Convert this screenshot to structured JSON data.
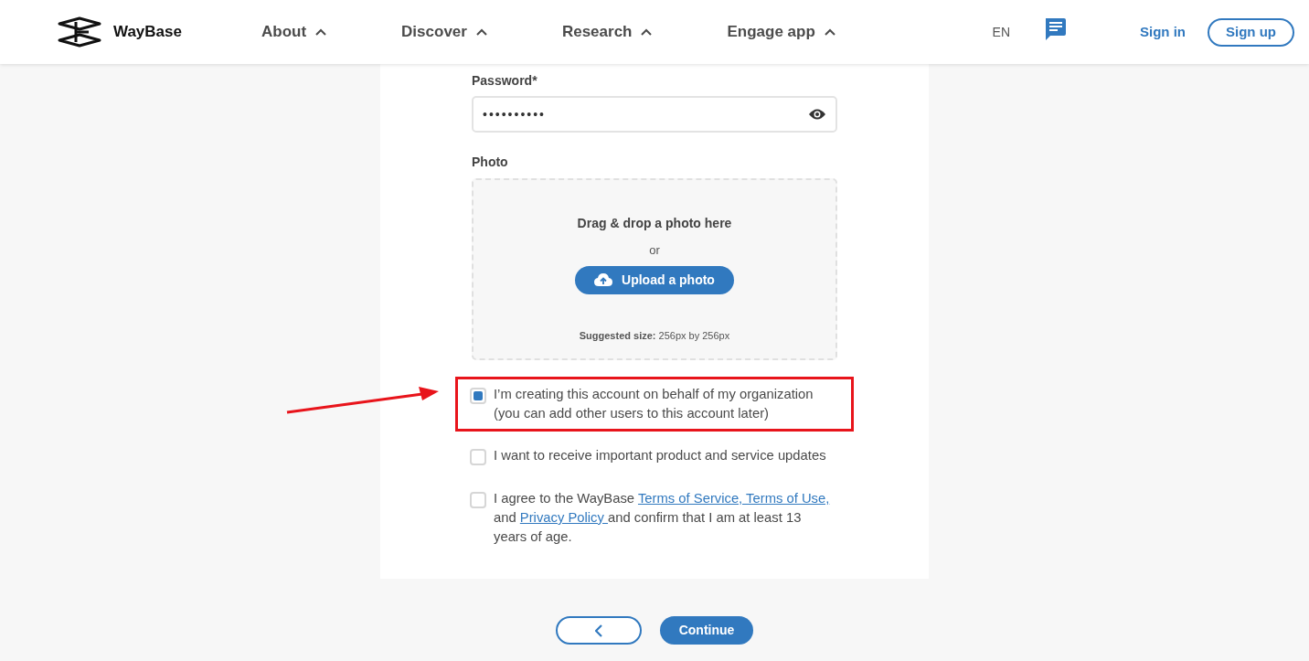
{
  "header": {
    "brand": "WayBase",
    "nav": [
      {
        "label": "About"
      },
      {
        "label": "Discover"
      },
      {
        "label": "Research"
      },
      {
        "label": "Engage app"
      }
    ],
    "language": "EN",
    "sign_in": "Sign in",
    "sign_up": "Sign up"
  },
  "form": {
    "password": {
      "label": "Password*",
      "value": "••••••••••"
    },
    "photo": {
      "label": "Photo",
      "drop_text": "Drag & drop a photo here",
      "or": "or",
      "upload_button": "Upload a photo",
      "size_hint": "**Suggested size:** 256px by 256px"
    },
    "checkboxes": [
      {
        "checked": true,
        "highlighted": true,
        "parts": [
          {
            "kind": "text",
            "text": "I’m creating this account on behalf of my organization (you can add other users to this account later)"
          }
        ]
      },
      {
        "checked": false,
        "highlighted": false,
        "parts": [
          {
            "kind": "text",
            "text": "I want to receive important product and service updates"
          }
        ]
      },
      {
        "checked": false,
        "highlighted": false,
        "parts": [
          {
            "kind": "text",
            "text": "I agree to the WayBase "
          },
          {
            "kind": "link",
            "text": "Terms of Service, Terms of Use,"
          },
          {
            "kind": "text",
            "text": " and "
          },
          {
            "kind": "link",
            "text": "Privacy Policy "
          },
          {
            "kind": "text",
            "text": "and confirm that I am at least 13 years of age."
          }
        ]
      }
    ]
  },
  "footer": {
    "continue": "Continue"
  }
}
